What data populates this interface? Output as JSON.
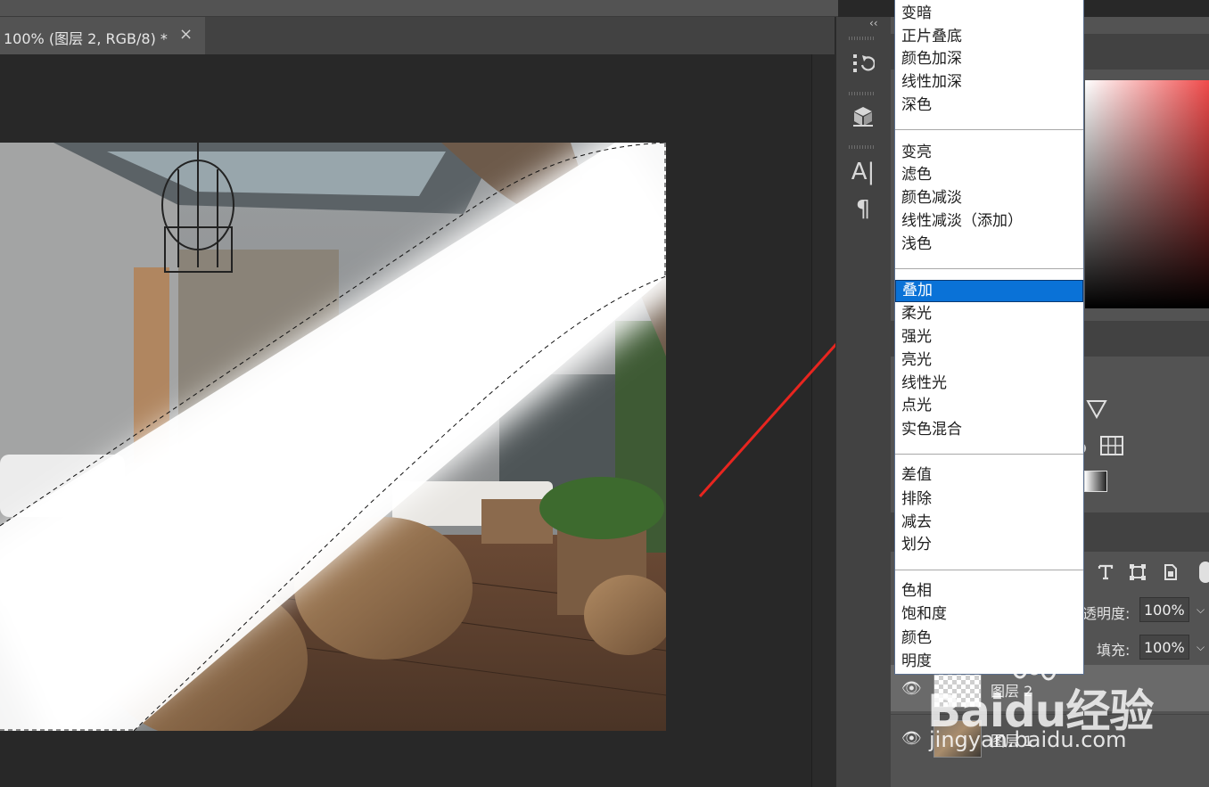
{
  "document_tab": {
    "title": "100% (图层 2, RGB/8) *",
    "close_glyph": "×"
  },
  "tool_strip": {
    "collapse_glyph": "‹‹",
    "icons": [
      "history-icon",
      "3d-cube-icon",
      "character-icon",
      "paragraph-icon"
    ],
    "character_glyph": "A|",
    "paragraph_glyph": "¶"
  },
  "blend_mode_menu": {
    "groups": [
      [
        "变暗",
        "正片叠底",
        "颜色加深",
        "线性加深",
        "深色"
      ],
      [
        "变亮",
        "滤色",
        "颜色减淡",
        "线性减淡（添加）",
        "浅色"
      ],
      [
        "叠加",
        "柔光",
        "强光",
        "亮光",
        "线性光",
        "点光",
        "实色混合"
      ],
      [
        "差值",
        "排除",
        "减去",
        "划分"
      ],
      [
        "色相",
        "饱和度",
        "颜色",
        "明度"
      ]
    ],
    "selected": "叠加"
  },
  "layers_panel": {
    "opacity_label": "透明度:",
    "opacity_value": "100%",
    "fill_label": "填充:",
    "fill_value": "100%",
    "layers": [
      {
        "name": "图层 2",
        "visible": true,
        "selected": true
      },
      {
        "name": "图层 1",
        "visible": true,
        "selected": false
      }
    ]
  },
  "watermark": {
    "logo": "Baidu经验",
    "url": "jingyan.baidu.com"
  },
  "colors": {
    "accent_selected": "#0a72d7",
    "arrow": "#e8251f",
    "panel_bg": "#535353",
    "canvas_bg": "#282828"
  }
}
